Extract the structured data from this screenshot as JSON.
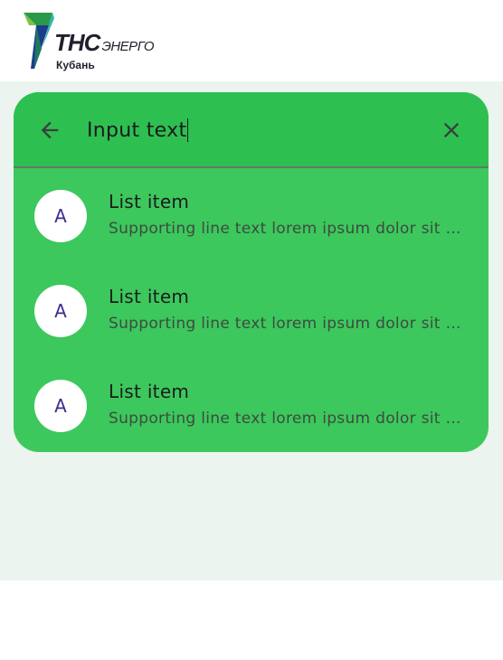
{
  "header": {
    "logo_brand": "ТНС",
    "logo_suffix": "ЭНЕРГО",
    "logo_region": "Кубань"
  },
  "search": {
    "value": "Input text",
    "back_icon": "arrow-back-icon",
    "clear_icon": "close-icon"
  },
  "results": [
    {
      "avatar": "A",
      "headline": "List item",
      "supporting": "Supporting line text lorem ipsum dolor sit amet, consectetur"
    },
    {
      "avatar": "A",
      "headline": "List item",
      "supporting": "Supporting line text lorem ipsum dolor sit amet, consectetur"
    },
    {
      "avatar": "A",
      "headline": "List item",
      "supporting": "Supporting line text lorem ipsum dolor sit amet, consectetur"
    }
  ],
  "colors": {
    "surface": "#ebf4ee",
    "search_view": "#3cc85c",
    "search_bar": "#2ebf51",
    "avatar_text": "#3a2f8f"
  }
}
